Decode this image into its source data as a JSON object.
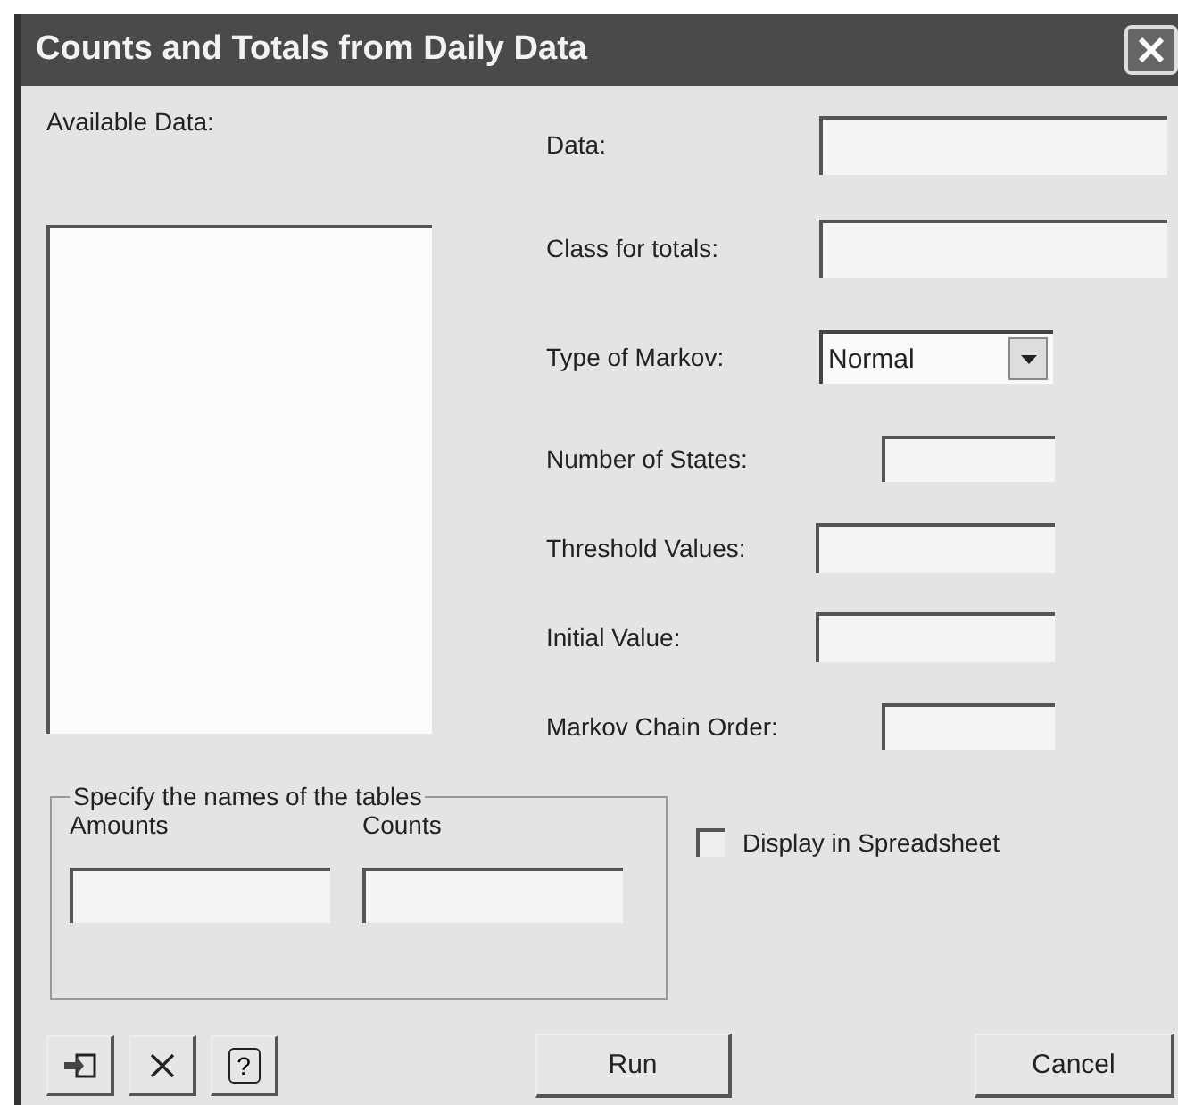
{
  "window": {
    "title": "Counts and Totals from Daily Data"
  },
  "available_data": {
    "label": "Available Data:"
  },
  "fields": [
    {
      "kind": "text",
      "label": "Data:"
    },
    {
      "kind": "text",
      "label": "Class for totals:"
    },
    {
      "kind": "combo",
      "label": "Type of Markov:",
      "value": "Normal"
    },
    {
      "kind": "text",
      "label": "Number of States:"
    },
    {
      "kind": "text",
      "label": "Threshold Values:"
    },
    {
      "kind": "text",
      "label": "Initial Value:"
    },
    {
      "kind": "text",
      "label": "Markov Chain Order:"
    }
  ],
  "tables_group": {
    "title": "Specify the names of the tables",
    "columns": [
      {
        "label": "Amounts"
      },
      {
        "label": "Counts"
      }
    ]
  },
  "display_in_spreadsheet": {
    "label": "Display in Spreadsheet",
    "checked": false
  },
  "icon_buttons": [
    {
      "kind": "exit"
    },
    {
      "kind": "clear"
    },
    {
      "kind": "help",
      "label": "?"
    }
  ],
  "buttons": [
    {
      "label": "Run"
    },
    {
      "label": "Cancel"
    }
  ]
}
